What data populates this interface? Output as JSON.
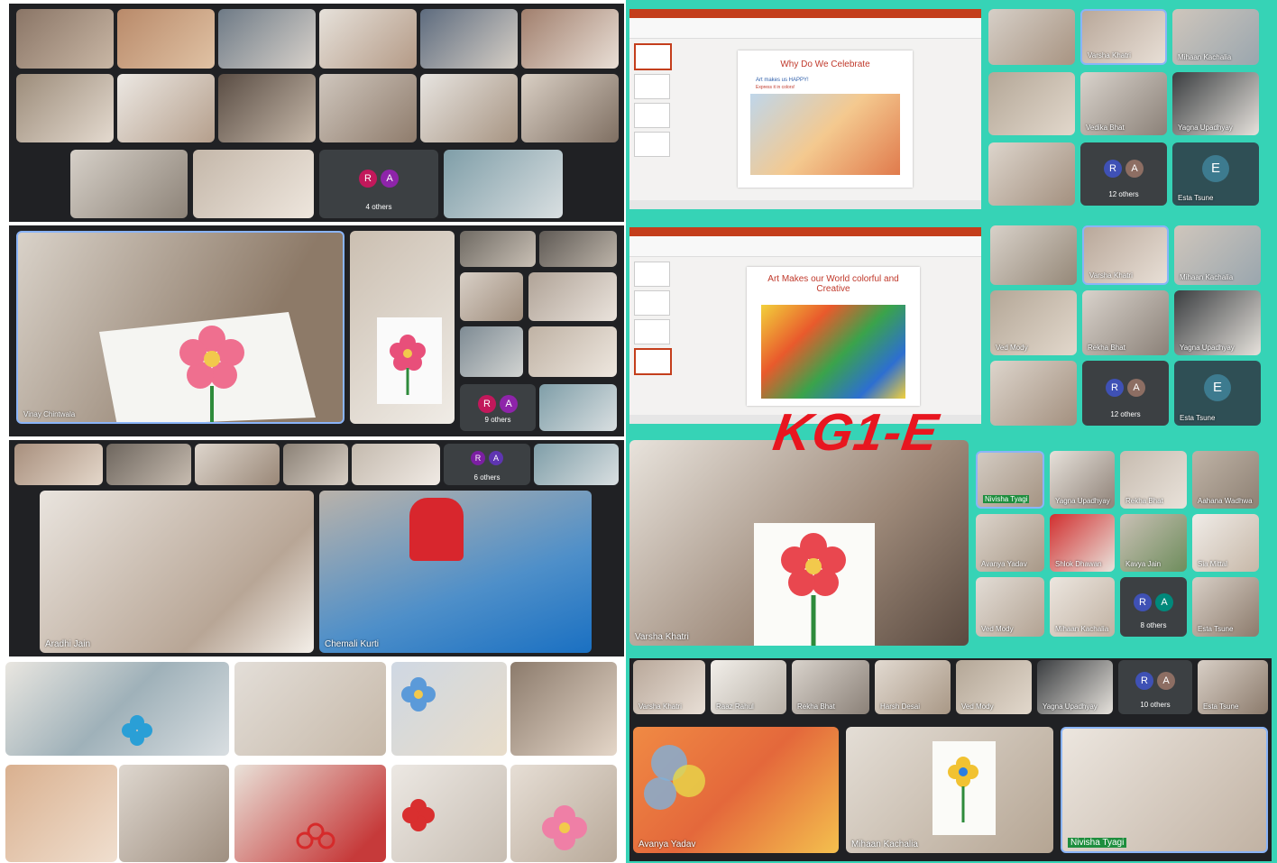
{
  "class_label": "KG1-E",
  "colors": {
    "teal": "#36d3b6",
    "meet_bg": "#202124",
    "slide_title": "#c0392b",
    "kg_red": "#e8161f"
  },
  "slides": {
    "slide1": {
      "title": "Why Do We Celebrate",
      "subtitle": "Art makes us HAPPY!",
      "caption": "Express it in colors!"
    },
    "slide2": {
      "title": "Art Makes our World colorful and Creative"
    }
  },
  "panel_a": {
    "others": "4 others"
  },
  "panel_b": {
    "name_main": "Vinay Chintwala",
    "others": "9 others"
  },
  "panel_c": {
    "others": "6 others",
    "name_left": "Aradhi Jain",
    "name_right": "Chemali Kurti"
  },
  "panel_d": {
    "names": [
      "Varsha Khatri",
      "Mihaan Kachalia",
      "Vedika Bhat",
      "Yagna Upadhyay"
    ],
    "others": "12 others",
    "last": "Esta Tsune",
    "avatars": [
      "R",
      "A"
    ],
    "bigav": "E"
  },
  "panel_e": {
    "names": [
      "Varsha Khatri",
      "Mihaan Kachalia",
      "Ved Mody",
      "Rekha Bhat",
      "Yagna Upadhyay"
    ],
    "others": "12 others",
    "last": "Esta Tsune",
    "avatars": [
      "R",
      "A"
    ],
    "bigav": "E"
  },
  "panel_f": {
    "main_name": "Varsha Khatri",
    "tiles": [
      "Nivisha Tyagi",
      "Yagna Upadhyay",
      "Rekha Bhat",
      "Aahana Wadhwa",
      "Avanya Yadav",
      "Shlok Dhawan",
      "Kavya Jain",
      "Sia Mittal",
      "Ved Mody",
      "Mihaan Kachalia",
      "Esta Tsune"
    ],
    "others": "8 others",
    "avatars": [
      "R",
      "A"
    ]
  },
  "panel_g": {
    "strip": [
      "Varsha Khatri",
      "Raaz Rahul",
      "Rekha Bhat",
      "Harsh Desai",
      "Ved Mody",
      "Yagna Upadhyay"
    ],
    "others": "10 others",
    "last": "Esta Tsune",
    "avatars": [
      "R",
      "A"
    ],
    "bottom": [
      "Avanya Yadav",
      "Mihaan Kachalia",
      "Nivisha Tyagi"
    ]
  }
}
